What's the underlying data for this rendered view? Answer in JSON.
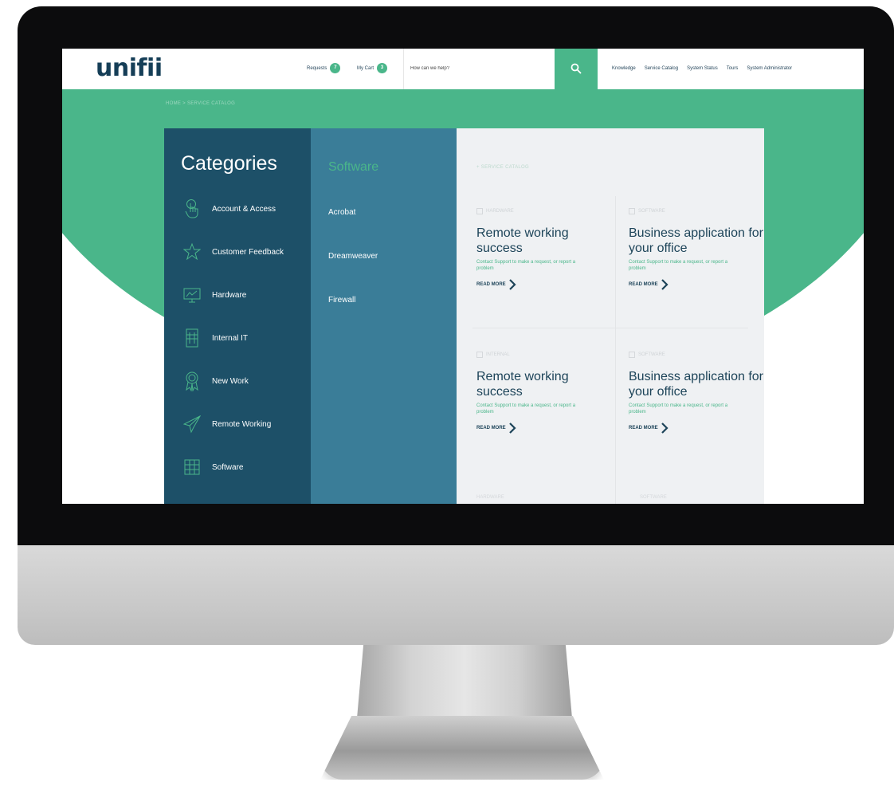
{
  "header": {
    "logo": "unifii",
    "requests_label": "Requests",
    "requests_count": "7",
    "cart_label": "My Cart",
    "cart_count": "3",
    "search_placeholder": "How can we help?",
    "nav": [
      "Knowledge",
      "Service Catalog",
      "System Status",
      "Tours",
      "System Administrator"
    ]
  },
  "breadcrumb": "HOME > SERVICE CATALOG",
  "categories": {
    "title": "Categories",
    "items": [
      {
        "label": "Account & Access",
        "icon": "hand-pointer-icon"
      },
      {
        "label": "Customer Feedback",
        "icon": "star-icon"
      },
      {
        "label": "Hardware",
        "icon": "monitor-chart-icon"
      },
      {
        "label": "Internal IT",
        "icon": "building-icon"
      },
      {
        "label": "New Work",
        "icon": "award-badge-icon"
      },
      {
        "label": "Remote Working",
        "icon": "paper-plane-icon"
      },
      {
        "label": "Software",
        "icon": "grid-icon"
      }
    ]
  },
  "software": {
    "title": "Software",
    "items": [
      "Acrobat",
      "Dreamweaver",
      "Firewall"
    ]
  },
  "content": {
    "breadcrumb": "+ SERVICE CATALOG",
    "cards": [
      {
        "tag": "HARDWARE",
        "title": "Remote working success",
        "desc": "Contact Support to make a request, or report a problem",
        "link": "READ MORE"
      },
      {
        "tag": "SOFTWARE",
        "title": "Business application for your office",
        "desc": "Contact Support to make a request, or report a problem",
        "link": "READ MORE"
      },
      {
        "tag": "INTERNAL",
        "title": "Remote working success",
        "desc": "Contact Support to make a request, or report a problem",
        "link": "READ MORE"
      },
      {
        "tag": "SOFTWARE",
        "title": "Business application for your office",
        "desc": "Contact Support to make a request, or report a problem",
        "link": "READ MORE"
      }
    ],
    "bottom_tags": [
      "HARDWARE",
      "SOFTWARE"
    ]
  },
  "colors": {
    "accent": "#4ab68a",
    "navy": "#1d5068",
    "teal": "#3a7d98",
    "panel_bg": "#eff1f3"
  }
}
